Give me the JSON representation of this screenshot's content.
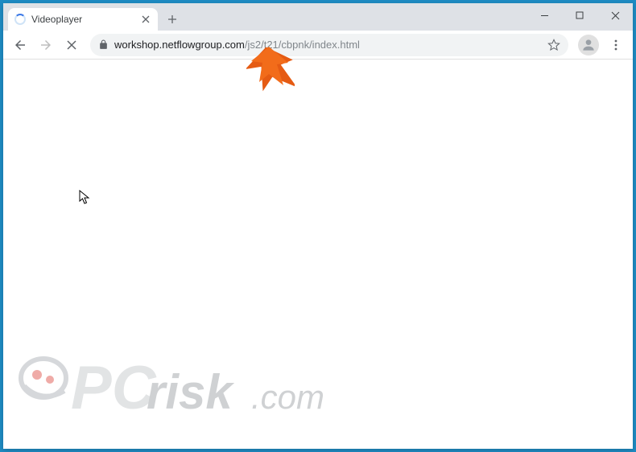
{
  "tab": {
    "title": "Videoplayer",
    "loading": true
  },
  "url": {
    "host": "workshop.netflowgroup.com",
    "path": "/js2/t21/cbpnk/index.html"
  },
  "watermark": {
    "brand_prefix": "PC",
    "brand_main": "risk",
    "tld": ".com"
  }
}
